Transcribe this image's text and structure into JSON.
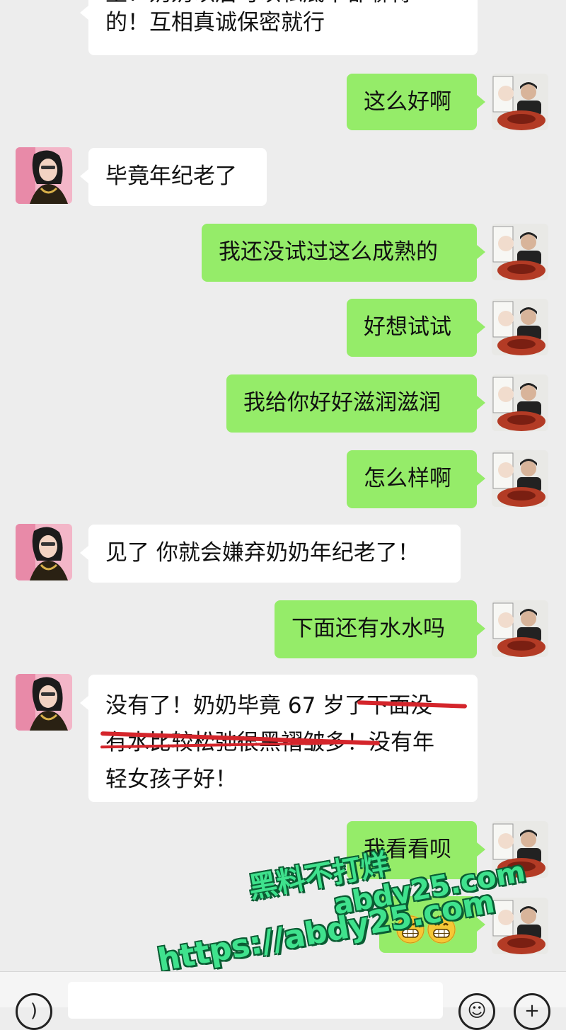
{
  "messages": [
    {
      "side": "left",
      "text_lines": [
        "生！奶奶以后可以私底下都聊得",
        "的！互相真诚保密就行"
      ]
    },
    {
      "side": "right",
      "text": "这么好啊"
    },
    {
      "side": "left",
      "text": "毕竟年纪老了"
    },
    {
      "side": "right",
      "text": "我还没试过这么成熟的"
    },
    {
      "side": "right",
      "text": "好想试试"
    },
    {
      "side": "right",
      "text": "我给你好好滋润滋润"
    },
    {
      "side": "right",
      "text": "怎么样啊"
    },
    {
      "side": "left",
      "text": "见了 你就会嫌弃奶奶年纪老了！"
    },
    {
      "side": "right",
      "text": "下面还有水水吗"
    },
    {
      "side": "left",
      "text_lines": [
        "没有了！奶奶毕竟 67 岁了下面没",
        "有水比较松弛很黑褶皱多！没有年",
        "轻女孩子好！"
      ]
    },
    {
      "side": "right",
      "text": "我看看呗"
    },
    {
      "side": "right",
      "emoji": [
        "grinning-face",
        "grinning-face"
      ]
    }
  ],
  "watermark": {
    "line1": "黑料不打烊",
    "line2": "abdy25.com",
    "line3": "https://abdy25.com"
  },
  "colors": {
    "background": "#ededed",
    "incoming_bubble": "#ffffff",
    "outgoing_bubble": "#95ec69",
    "strike_mark": "#d4252b",
    "watermark": "#3fe28d"
  }
}
